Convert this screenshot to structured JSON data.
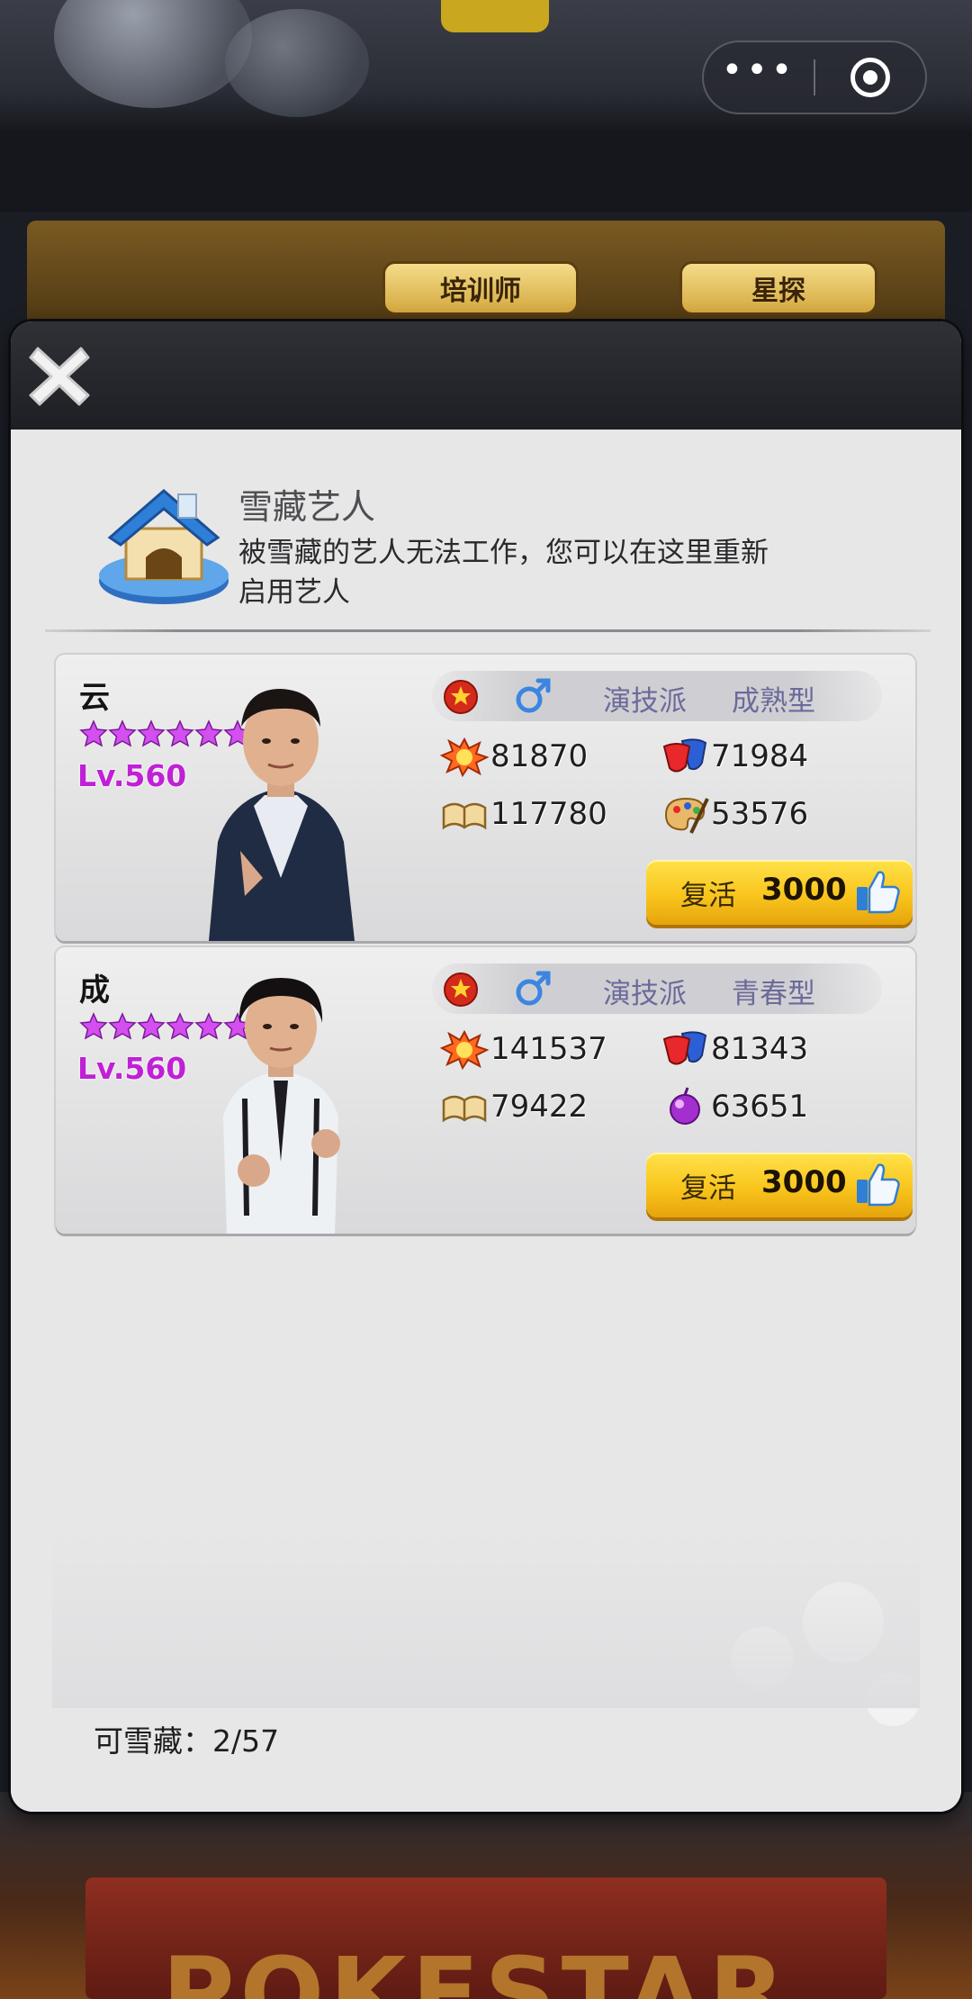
{
  "capsule": {
    "more_icon": "more-dots-icon",
    "close_icon": "target-circle-icon"
  },
  "background": {
    "sign_left": "培训师",
    "sign_right": "星探",
    "bottom_logo": "POKESTAR"
  },
  "modal": {
    "close_icon": "close-x-icon",
    "header_icon": "doghouse-icon",
    "title": "雪藏艺人",
    "description": "被雪藏的艺人无法工作，您可以在这里重新启用艺人",
    "footer_label": "可雪藏：",
    "footer_value": "2/57"
  },
  "artists": [
    {
      "name": "云",
      "stars": 6,
      "level": "Lv.560",
      "country_icon": "china-flag-icon",
      "gender_icon": "male-icon",
      "style": "演技派",
      "type": "成熟型",
      "stats": [
        {
          "icon": "explosion-icon",
          "value": "81870"
        },
        {
          "icon": "drama-mask-icon",
          "value": "71984"
        },
        {
          "icon": "book-icon",
          "value": "117780"
        },
        {
          "icon": "paint-palette-icon",
          "value": "53576"
        }
      ],
      "revive_label": "复活",
      "revive_cost": "3000",
      "revive_icon": "thumbs-up-icon"
    },
    {
      "name": "成",
      "stars": 6,
      "level": "Lv.560",
      "country_icon": "china-flag-icon",
      "gender_icon": "male-icon",
      "style": "演技派",
      "type": "青春型",
      "stats": [
        {
          "icon": "explosion-icon",
          "value": "141537"
        },
        {
          "icon": "drama-mask-icon",
          "value": "81343"
        },
        {
          "icon": "book-icon",
          "value": "79422"
        },
        {
          "icon": "purple-orb-icon",
          "value": "63651"
        }
      ],
      "revive_label": "复活",
      "revive_cost": "3000",
      "revive_icon": "thumbs-up-icon"
    }
  ],
  "colors": {
    "level_purple": "#c020d6",
    "star_purple": "#d34ff0",
    "button_yellow": "#f9c51d",
    "tag_text": "#6b6a9a"
  }
}
